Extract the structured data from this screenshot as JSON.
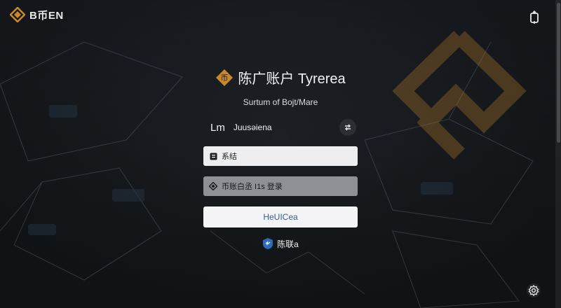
{
  "brand": {
    "name": "B币ЕN",
    "logo_icon": "coin-logo-icon"
  },
  "header": {
    "top_right_icon": "device-sync-icon"
  },
  "login": {
    "title": "陈广账户 Tyrerea",
    "subtitle": "Surtum of Bojt/Mare",
    "user": {
      "abbr": "Lm",
      "name": "Juusəiena"
    },
    "field1_label": "系结",
    "field2_label": "币账白丞 I1s 登录",
    "submit_label": "HeUICea",
    "alt_label": "陈联a"
  },
  "footer": {
    "settings_icon": "settings-icon"
  },
  "colors": {
    "accent": "#c9892a",
    "bg": "#1b1e22",
    "link": "#315c99"
  }
}
